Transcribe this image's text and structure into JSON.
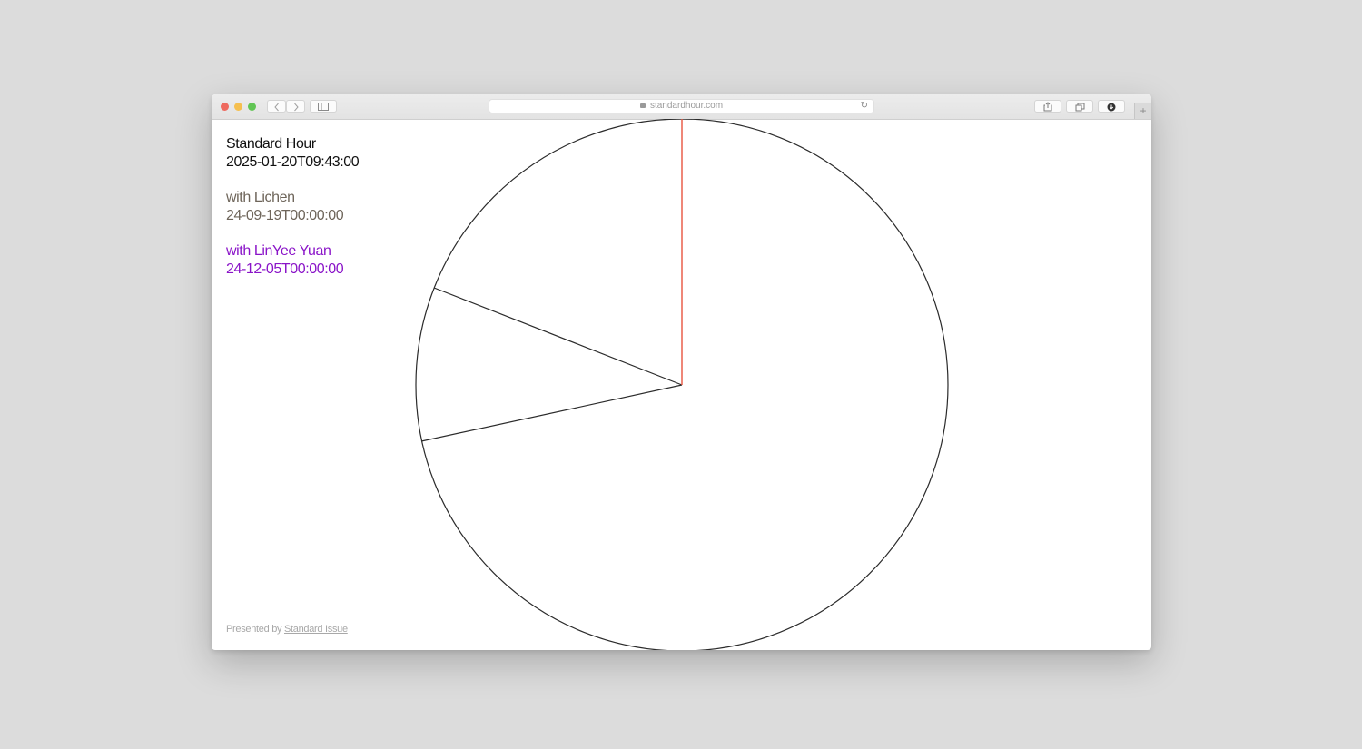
{
  "browser": {
    "url": "standardhour.com"
  },
  "clock": {
    "title": "Standard Hour",
    "timestamp": "2025-01-20T09:43:00",
    "hand_color": "#e8543e",
    "sectors": [
      {
        "label": "with Lichen",
        "date": "24-09-19T00:00:00",
        "color": "#6e655a"
      },
      {
        "label": "with LinYee Yuan",
        "date": "24-12-05T00:00:00",
        "color": "#8a14c8"
      }
    ]
  },
  "footer": {
    "prefix": "Presented by",
    "link": "Standard Issue"
  }
}
